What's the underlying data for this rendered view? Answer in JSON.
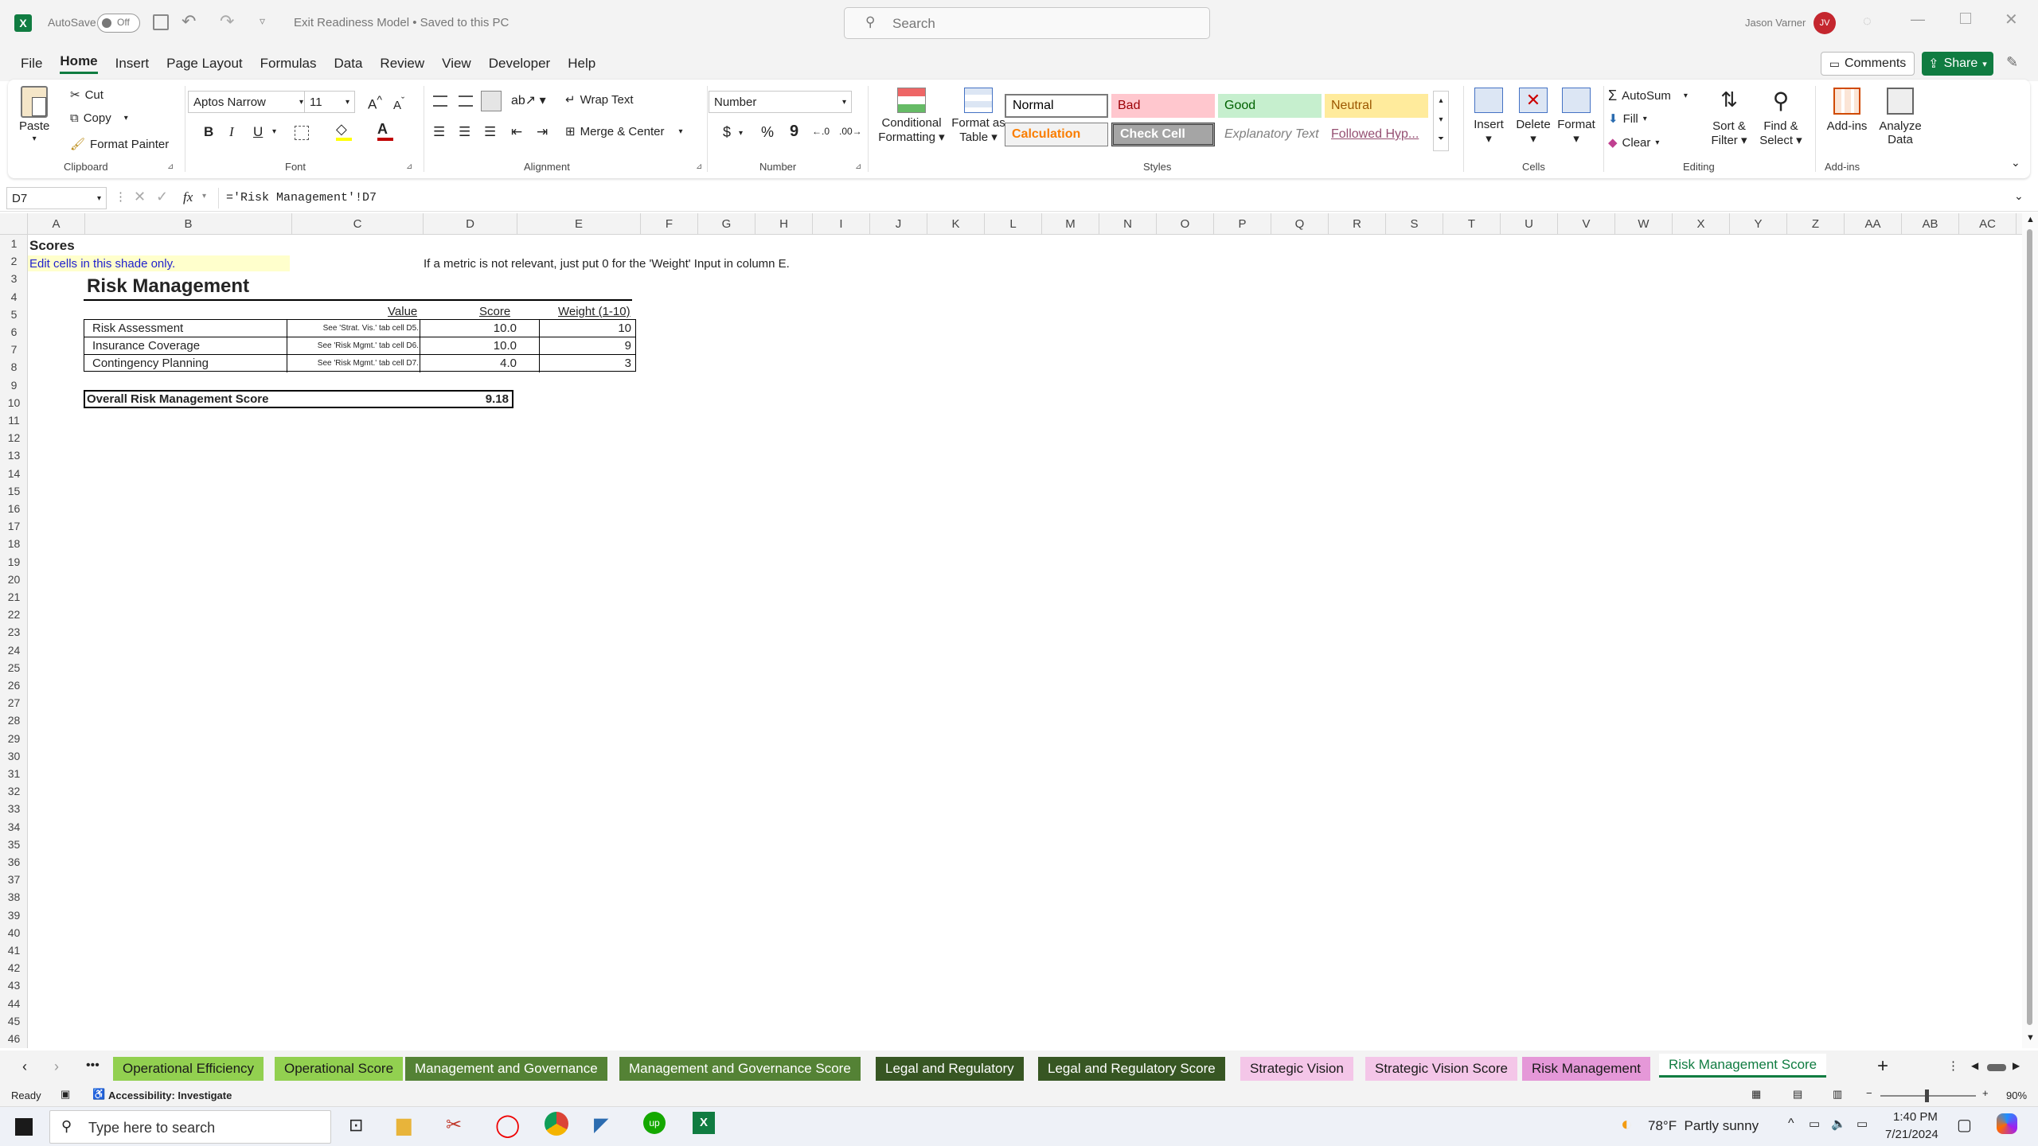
{
  "titlebar": {
    "autosave_label": "AutoSave",
    "autosave_state": "Off",
    "doc_title": "Exit Readiness Model • Saved to this PC",
    "search_placeholder": "Search",
    "user_name": "Jason Varner",
    "user_initials": "JV"
  },
  "menu": [
    "File",
    "Home",
    "Insert",
    "Page Layout",
    "Formulas",
    "Data",
    "Review",
    "View",
    "Developer",
    "Help"
  ],
  "menu_active": "Home",
  "comments_label": "Comments",
  "share_label": "Share",
  "ribbon": {
    "clipboard": {
      "paste": "Paste",
      "cut": "Cut",
      "copy": "Copy",
      "format_painter": "Format Painter",
      "group": "Clipboard"
    },
    "font": {
      "name": "Aptos Narrow",
      "size": "11",
      "bold": "B",
      "italic": "I",
      "underline": "U",
      "group": "Font"
    },
    "alignment": {
      "wrap": "Wrap Text",
      "merge": "Merge & Center",
      "group": "Alignment"
    },
    "number": {
      "format": "Number",
      "currency": "$",
      "percent": "%",
      "comma": "9",
      "group": "Number"
    },
    "styles": {
      "conditional": "Conditional Formatting",
      "format_table": "Format as Table",
      "normal": "Normal",
      "bad": "Bad",
      "good": "Good",
      "neutral": "Neutral",
      "calculation": "Calculation",
      "check_cell": "Check Cell",
      "explanatory": "Explanatory Text",
      "followed": "Followed Hyp...",
      "group": "Styles"
    },
    "cells": {
      "insert": "Insert",
      "delete": "Delete",
      "format": "Format",
      "group": "Cells"
    },
    "editing": {
      "autosum": "AutoSum",
      "fill": "Fill",
      "clear": "Clear",
      "sort": "Sort & Filter",
      "find": "Find & Select",
      "group": "Editing"
    },
    "addins": {
      "addins": "Add-ins",
      "analyze": "Analyze Data",
      "group": "Add-ins"
    }
  },
  "formula_bar": {
    "name_box": "D7",
    "fx": "fx",
    "formula": "='Risk Management'!D7"
  },
  "columns": [
    "A",
    "B",
    "C",
    "D",
    "E",
    "F",
    "G",
    "H",
    "I",
    "J",
    "K",
    "L",
    "M",
    "N",
    "O",
    "P",
    "Q",
    "R",
    "S",
    "T",
    "U",
    "V",
    "W",
    "X",
    "Y",
    "Z",
    "AA",
    "AB",
    "AC"
  ],
  "sheet": {
    "a1": "Scores",
    "a2": "Edit cells in this shade only.",
    "note": "If a metric is not relevant, just put 0 for the 'Weight' Input in column E.",
    "title": "Risk Management",
    "headers": {
      "value": "Value",
      "score": "Score",
      "weight": "Weight (1-10)"
    },
    "rows": [
      {
        "metric": "Risk Assessment",
        "ref": "See 'Strat. Vis.' tab cell D5.",
        "score": "10.0",
        "weight": "10"
      },
      {
        "metric": "Insurance Coverage",
        "ref": "See 'Risk Mgmt.' tab cell D6.",
        "score": "10.0",
        "weight": "9"
      },
      {
        "metric": "Contingency Planning",
        "ref": "See 'Risk Mgmt.' tab cell D7.",
        "score": "4.0",
        "weight": "3"
      }
    ],
    "overall_label": "Overall Risk Management Score",
    "overall_value": "9.18"
  },
  "tabs": [
    {
      "label": "Operational Efficiency",
      "bg": "#92d050",
      "fg": "#1a1a1a"
    },
    {
      "label": "Operational Score",
      "bg": "#92d050",
      "fg": "#1a1a1a"
    },
    {
      "label": "Management and Governance",
      "bg": "#548235",
      "fg": "#ffffff"
    },
    {
      "label": "Management and Governance Score",
      "bg": "#548235",
      "fg": "#ffffff"
    },
    {
      "label": "Legal and Regulatory",
      "bg": "#375623",
      "fg": "#ffffff"
    },
    {
      "label": "Legal and Regulatory Score",
      "bg": "#375623",
      "fg": "#ffffff"
    },
    {
      "label": "Strategic Vision",
      "bg": "#f4c6e8",
      "fg": "#1a1a1a"
    },
    {
      "label": "Strategic Vision Score",
      "bg": "#f4c6e8",
      "fg": "#1a1a1a"
    },
    {
      "label": "Risk Management",
      "bg": "#e598d8",
      "fg": "#1a1a1a"
    },
    {
      "label": "Risk Management Score",
      "bg": "#ffffff",
      "fg": "#107c41"
    }
  ],
  "status": {
    "ready": "Ready",
    "accessibility": "Accessibility: Investigate",
    "zoom": "90%"
  },
  "taskbar": {
    "search_placeholder": "Type here to search",
    "weather": "78°F  Partly sunny",
    "time": "1:40 PM",
    "date": "7/21/2024"
  }
}
